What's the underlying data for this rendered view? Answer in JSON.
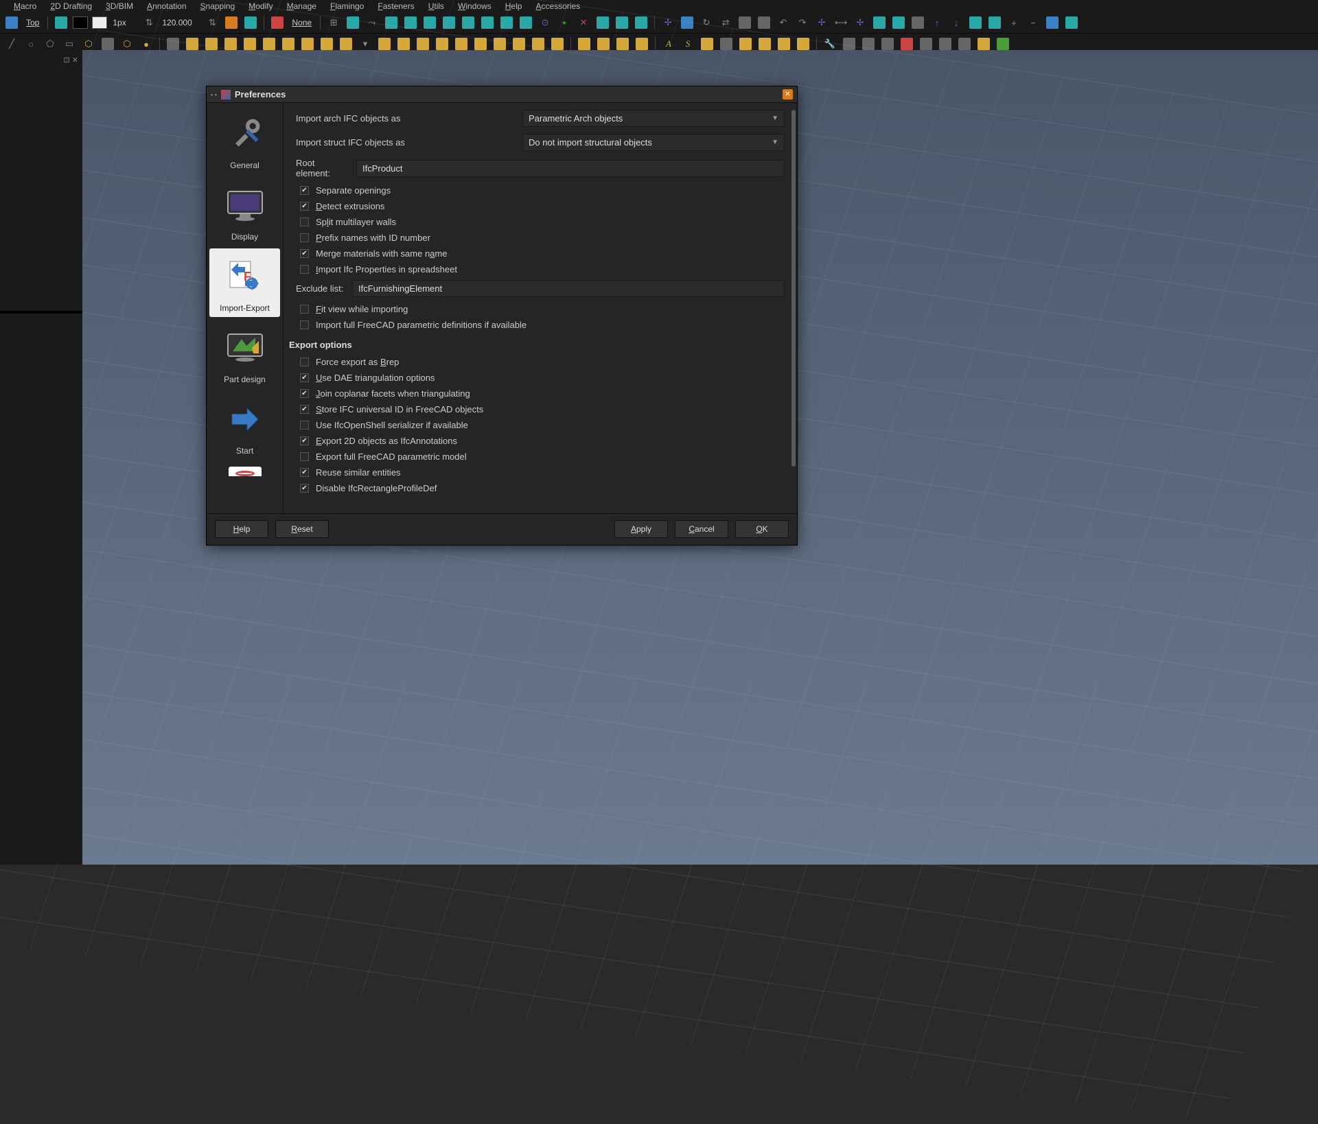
{
  "menu": {
    "items": [
      "Macro",
      "2D Drafting",
      "3D/BIM",
      "Annotation",
      "Snapping",
      "Modify",
      "Manage",
      "Flamingo",
      "Fasteners",
      "Utils",
      "Windows",
      "Help",
      "Accessories"
    ]
  },
  "toolbar1": {
    "view_label": "Top",
    "px_value": "1px",
    "dim_value": "120.000",
    "none_label": "None"
  },
  "dialog": {
    "title": "Preferences",
    "nav": {
      "general": "General",
      "display": "Display",
      "import_export": "Import-Export",
      "part_design": "Part design",
      "start": "Start"
    },
    "form": {
      "import_arch_label": "Import arch IFC objects as",
      "import_arch_value": "Parametric Arch objects",
      "import_struct_label": "Import struct IFC objects as",
      "import_struct_value": "Do not import structural objects",
      "root_element_label": "Root element:",
      "root_element_value": "IfcProduct",
      "cb_separate_openings": "Separate openings",
      "cb_detect_extrusions": "Detect extrusions",
      "cb_split_walls": "Split multilayer walls",
      "cb_prefix_id": "Prefix names with ID number",
      "cb_merge_materials": "Merge materials with same name",
      "cb_import_ifc_props": "Import Ifc Properties in spreadsheet",
      "exclude_list_label": "Exclude list:",
      "exclude_list_value": "IfcFurnishingElement",
      "cb_fit_view": "Fit view while importing",
      "cb_import_full_param": "Import full FreeCAD parametric definitions if available",
      "export_heading": "Export options",
      "cb_force_brep": "Force export as Brep",
      "cb_use_dae_tri": "Use DAE triangulation options",
      "cb_join_coplanar": "Join coplanar facets when triangulating",
      "cb_store_ifc_id": "Store IFC universal ID in FreeCAD objects",
      "cb_use_ifcopenshell": "Use IfcOpenShell serializer if available",
      "cb_export_2d": "Export 2D objects as IfcAnnotations",
      "cb_export_full_param": "Export full FreeCAD parametric model",
      "cb_reuse_similar": "Reuse similar entities",
      "cb_disable_rect": "Disable IfcRectangleProfileDef"
    },
    "checked_state": {
      "separate_openings": true,
      "detect_extrusions": true,
      "split_walls": false,
      "prefix_id": false,
      "merge_materials": true,
      "import_ifc_props": false,
      "fit_view": false,
      "import_full_param": false,
      "force_brep": false,
      "use_dae_tri": true,
      "join_coplanar": true,
      "store_ifc_id": true,
      "use_ifcopenshell": false,
      "export_2d": true,
      "export_full_param": false,
      "reuse_similar": true,
      "disable_rect": true
    },
    "buttons": {
      "help": "Help",
      "reset": "Reset",
      "apply": "Apply",
      "cancel": "Cancel",
      "ok": "OK"
    }
  }
}
